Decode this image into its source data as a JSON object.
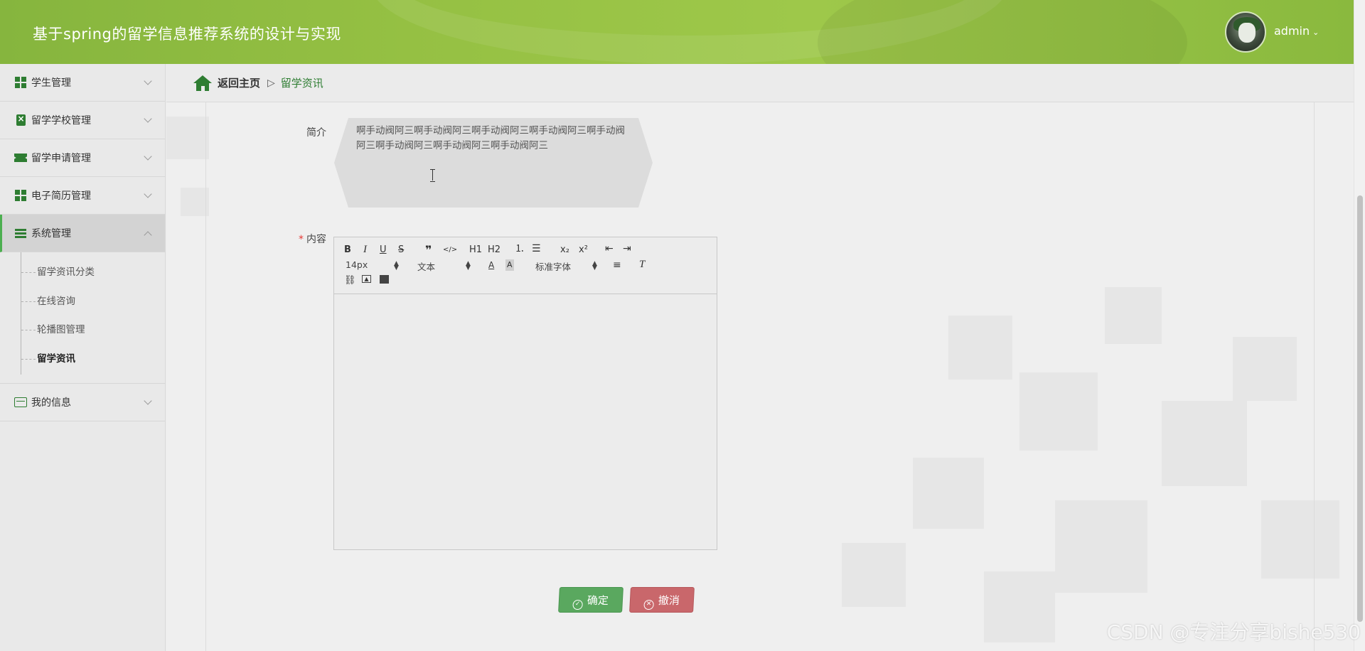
{
  "app": {
    "title": "基于spring的留学信息推荐系统的设计与实现",
    "user": "admin"
  },
  "sidebar": {
    "items": [
      {
        "label": "学生管理",
        "icon": "grid-icon"
      },
      {
        "label": "留学学校管理",
        "icon": "clipboard-icon"
      },
      {
        "label": "留学申请管理",
        "icon": "ticket-icon"
      },
      {
        "label": "电子简历管理",
        "icon": "grid-icon"
      },
      {
        "label": "系统管理",
        "icon": "list-icon",
        "expanded": true
      },
      {
        "label": "我的信息",
        "icon": "card-icon"
      }
    ],
    "submenu": [
      {
        "label": "留学资讯分类"
      },
      {
        "label": "在线咨询"
      },
      {
        "label": "轮播图管理"
      },
      {
        "label": "留学资讯",
        "active": true
      }
    ]
  },
  "breadcrumb": {
    "home": "返回主页",
    "separator": "▷",
    "current": "留学资讯"
  },
  "form": {
    "intro_label": "简介",
    "intro_value": "啊手动阀阿三啊手动阀阿三啊手动阀阿三啊手动阀阿三啊手动阀阿三啊手动阀阿三啊手动阀阿三啊手动阀阿三",
    "content_label": "内容",
    "content_required": "*",
    "editor": {
      "buttons": [
        "B",
        "I",
        "U",
        "S",
        "❞",
        "</>",
        "H1",
        "H2",
        "ordered-list",
        "bullet-list",
        "x₂",
        "x²",
        "outdent",
        "indent"
      ],
      "font_size": "14px",
      "text_style": "文本",
      "font_family": "标准字体",
      "content": ""
    },
    "submit_label": "确定",
    "cancel_label": "撤消"
  },
  "watermark": "CSDN @专注分享bishe530",
  "colors": {
    "header": "#95c043",
    "accent": "#2e7d32",
    "submit": "#5aa85f",
    "cancel": "#c9676b"
  }
}
